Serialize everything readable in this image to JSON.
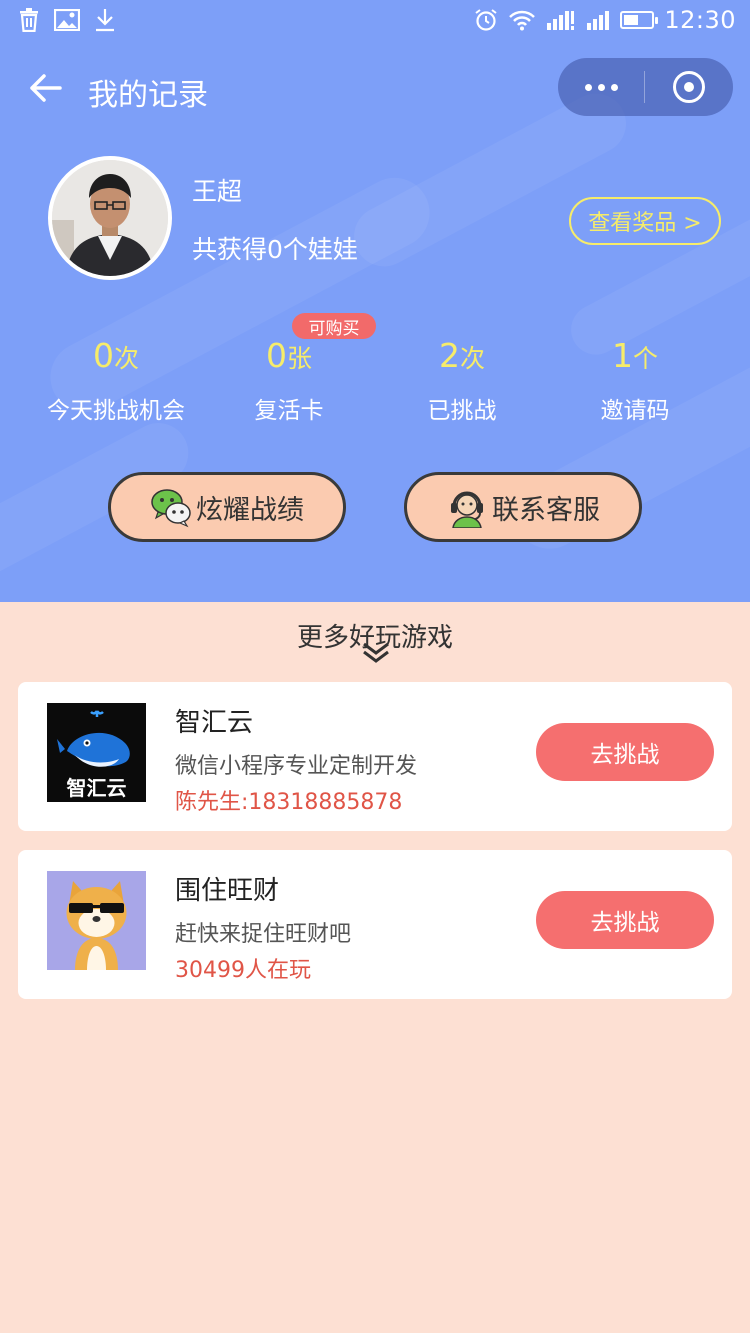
{
  "status_bar": {
    "left_icons": [
      "trash-icon",
      "image-icon",
      "download-icon"
    ],
    "right_icons": [
      "alarm-icon",
      "wifi-icon",
      "signal-icon",
      "signal-icon",
      "battery-icon"
    ],
    "battery_level": 0.55,
    "time": "12:30"
  },
  "nav": {
    "back_icon": "arrow-left-icon",
    "title": "我的记录",
    "capsule_more_icon": "more-dots-icon",
    "capsule_close_icon": "target-circle-icon"
  },
  "profile": {
    "name": "王超",
    "summary": "共获得0个娃娃",
    "prize_button": "查看奖品 >"
  },
  "stats": [
    {
      "value": "0",
      "unit": "次",
      "label": "今天挑战机会"
    },
    {
      "value": "0",
      "unit": "张",
      "label": "复活卡"
    },
    {
      "value": "2",
      "unit": "次",
      "label": "已挑战"
    },
    {
      "value": "1",
      "unit": "个",
      "label": "邀请码"
    }
  ],
  "badge": "可购买",
  "actions": {
    "share": {
      "label": "炫耀战绩",
      "icon": "wechat-icon"
    },
    "service": {
      "label": "联系客服",
      "icon": "headset-icon"
    }
  },
  "more_games": {
    "title": "更多好玩游戏",
    "chevron_icon": "double-chevron-down-icon",
    "items": [
      {
        "title": "智汇云",
        "desc": "微信小程序专业定制开发",
        "meta": "陈先生:18318885878",
        "button": "去挑战",
        "logo_text": "智汇云",
        "logo_icon": "whale-logo-icon"
      },
      {
        "title": "围住旺财",
        "desc": "赶快来捉住旺财吧",
        "meta": "30499人在玩",
        "button": "去挑战",
        "logo_icon": "shiba-dog-icon"
      }
    ]
  },
  "colors": {
    "header_bg": "#7d9ff8",
    "page_bg": "#fde0d3",
    "accent_yellow": "#f6ec6a",
    "button_red": "#f56f6f",
    "action_bg": "#fbcbb0"
  }
}
